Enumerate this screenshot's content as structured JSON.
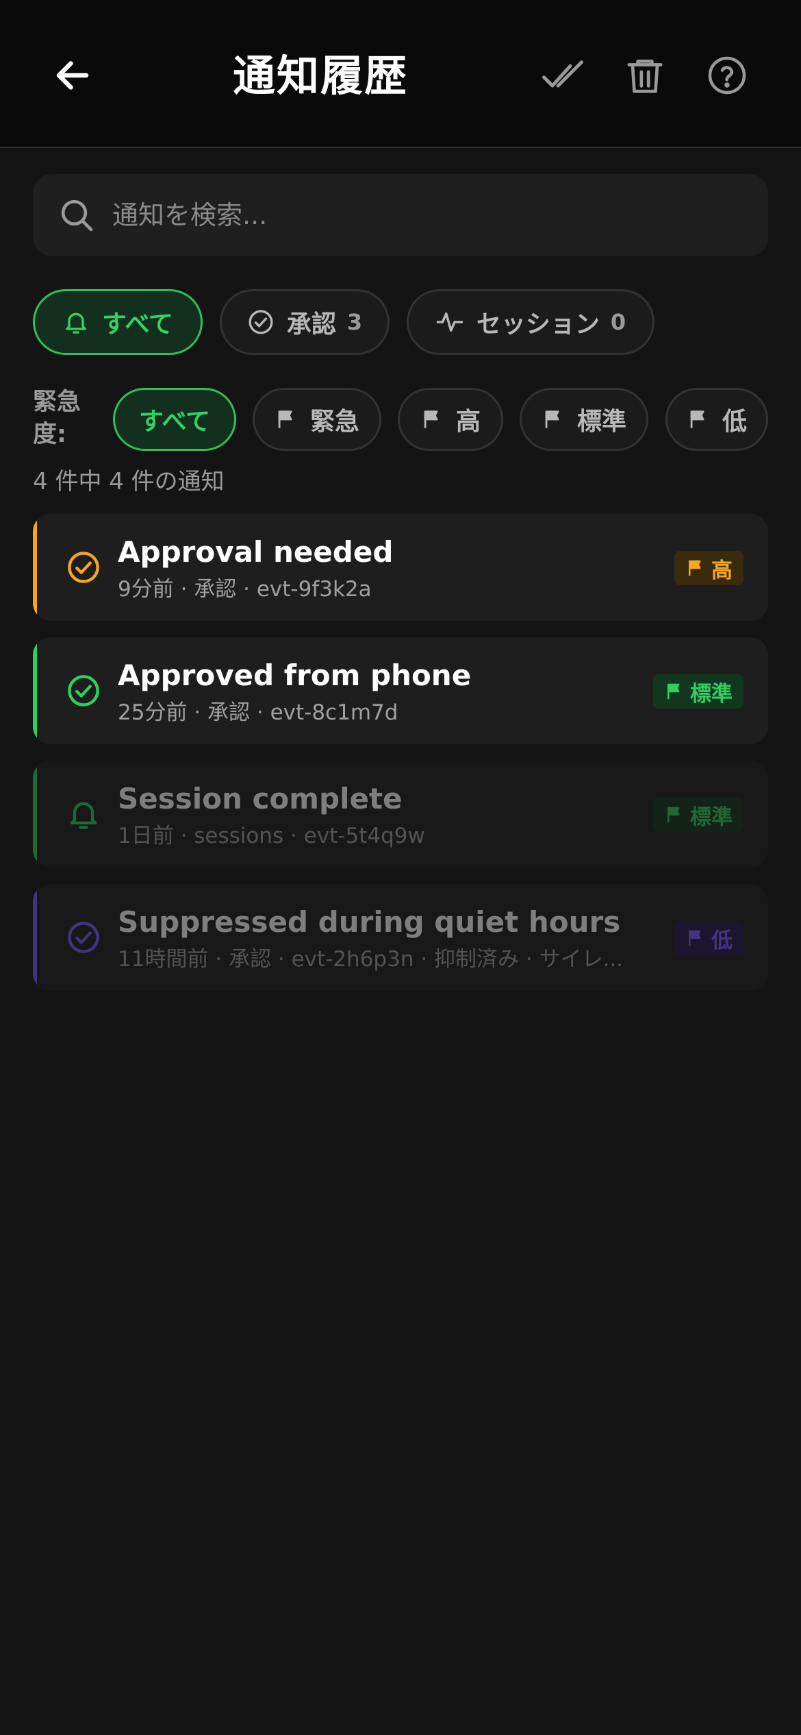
{
  "header": {
    "title": "通知履歴",
    "back_icon": "arrow-left-icon",
    "mark_all_read_icon": "double-check-icon",
    "delete_icon": "trash-icon",
    "help_icon": "help-circle-icon"
  },
  "search": {
    "placeholder": "通知を検索...",
    "value": ""
  },
  "type_filters": [
    {
      "label": "すべて",
      "icon": "bell-icon",
      "count": "",
      "active": true
    },
    {
      "label": "承認",
      "icon": "check-circle-icon",
      "count": "3",
      "active": false
    },
    {
      "label": "セッション",
      "icon": "activity-icon",
      "count": "0",
      "active": false
    }
  ],
  "urgency": {
    "label_line1": "緊急",
    "label_line2": "度:",
    "filters": [
      {
        "label": "すべて",
        "icon": "",
        "active": true
      },
      {
        "label": "緊急",
        "icon": "flag-icon",
        "active": false
      },
      {
        "label": "高",
        "icon": "flag-icon",
        "active": false
      },
      {
        "label": "標準",
        "icon": "flag-icon",
        "active": false
      },
      {
        "label": "低",
        "icon": "flag-icon",
        "active": false
      }
    ]
  },
  "summary": "4 件中 4 件の通知",
  "notifications": [
    {
      "title": "Approval needed",
      "meta": "9分前 · 承認 · evt-9f3k2a",
      "icon": "check-circle-icon",
      "priority": "高",
      "accent": "#f5a623",
      "read": false
    },
    {
      "title": "Approved from phone",
      "meta": "25分前 · 承認 · evt-8c1m7d",
      "icon": "check-circle-icon",
      "priority": "標準",
      "accent": "#2fcf62",
      "read": false
    },
    {
      "title": "Session complete",
      "meta": "1日前 · sessions · evt-5t4q9w",
      "icon": "bell-icon",
      "priority": "標準",
      "accent": "#2fcf62",
      "read": true
    },
    {
      "title": "Suppressed during quiet hours",
      "meta": "11時間前 · 承認 · evt-2h6p3n · 抑制済み · サイレ...",
      "icon": "check-circle-icon",
      "priority": "低",
      "accent": "#7b5cff",
      "read": true
    }
  ],
  "colors": {
    "background": "#141414",
    "header": "#0a0a0a",
    "active_green": "#34d167",
    "high": "#f5a623",
    "normal": "#2fcf62",
    "low": "#7b5cff"
  }
}
